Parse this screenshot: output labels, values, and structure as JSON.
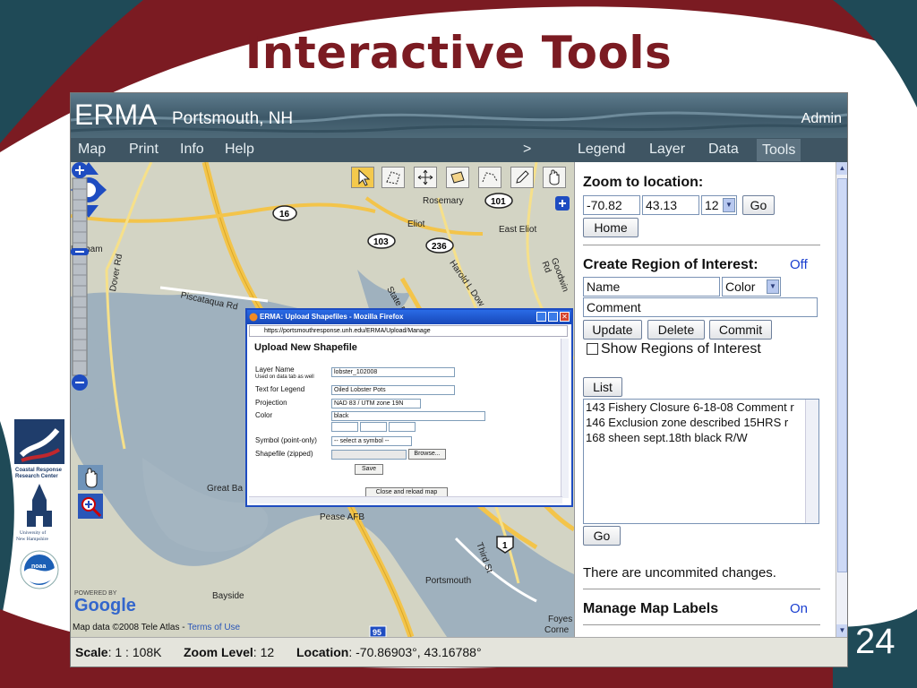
{
  "slide": {
    "title": "Interactive Tools",
    "page_number": "24",
    "logos": {
      "crrc": "Coastal Response Research Center",
      "unh": "University of New Hampshire",
      "noaa": "NOAA"
    }
  },
  "app": {
    "name": "ERMA",
    "location": "Portsmouth, NH",
    "user": "Admin"
  },
  "nav": {
    "left": [
      "Map",
      "Print",
      "Info",
      "Help"
    ],
    "arrow": ">",
    "right": [
      "Legend",
      "Layer",
      "Data",
      "Tools"
    ],
    "active": "Tools"
  },
  "map": {
    "labels": {
      "durham": "Durham",
      "piscataqua": "Piscataqua Rd",
      "rosemary": "Rosemary",
      "eliot": "Eliot",
      "east_eliot": "East Eliot",
      "great_bay": "Great Ba",
      "pease": "Pease AFB",
      "portsmouth": "Portsmouth",
      "bayside": "Bayside",
      "foyes": "Foyes",
      "corne": "Corne",
      "dover_rd": "Dover Rd",
      "harold": "Harold L Dow",
      "goodwin": "Goodwin Rd",
      "state_rt": "State Rt",
      "third": "Third St"
    },
    "shields": [
      "16",
      "101",
      "103",
      "236",
      "1",
      "95"
    ],
    "powered_by": "POWERED BY",
    "google": "Google",
    "copyright_prefix": "Map data ©2008 Tele Atlas - ",
    "terms": "Terms of Use",
    "tools": [
      "select-arrow-icon",
      "polygon-icon",
      "move-icon",
      "rectangle-icon",
      "polyline-icon",
      "pencil-icon",
      "hand-icon"
    ]
  },
  "panel": {
    "zoom_title": "Zoom to location:",
    "lon": "-70.82",
    "lat": "43.13",
    "zoom_level": "12",
    "go": "Go",
    "home": "Home",
    "roi_title": "Create Region of Interest:",
    "roi_state": "Off",
    "name_placeholder": "Name",
    "color_select": "Color",
    "comment_placeholder": "Comment",
    "update": "Update",
    "delete": "Delete",
    "commit": "Commit",
    "show_regions": "Show Regions of Interest",
    "list_btn": "List",
    "list_items": [
      "143 Fishery Closure 6-18-08 Comment r",
      "146 Exclusion zone described 15HRS r",
      "168 sheen sept.18th black R/W"
    ],
    "go2": "Go",
    "uncommitted": "There are uncommited changes.",
    "labels_title": "Manage Map Labels",
    "labels_state": "On"
  },
  "status": {
    "scale_label": "Scale",
    "scale_value": ": 1 : 108K",
    "zoom_label": "Zoom Level",
    "zoom_value": ": 12",
    "location_label": "Location",
    "location_value": ": -70.86903°, 43.16788°"
  },
  "dialog": {
    "title": "ERMA: Upload Shapefiles - Mozilla Firefox",
    "url": "https://portsmouthresponse.unh.edu/ERMA/Upload/Manage",
    "heading": "Upload New Shapefile",
    "layer_name_label": "Layer Name",
    "layer_name_sub": "Used on data tab as well",
    "layer_name_value": "lobster_102008",
    "legend_label": "Text for Legend",
    "legend_value": "Oiled Lobster Pots",
    "projection_label": "Projection",
    "projection_value": "NAD 83 / UTM zone 19N",
    "color_label": "Color",
    "color_value": "black",
    "symbol_label": "Symbol (point-only)",
    "symbol_value": "-- select a symbol --",
    "shapefile_label": "Shapefile (zipped)",
    "browse": "Browse...",
    "save": "Save",
    "close": "Close and reload map"
  },
  "colors": {
    "slide_maroon": "#7b1b22",
    "slide_teal": "#1f4a57",
    "nav_bg": "#3f5563",
    "water": "#9fb1be",
    "land": "#d2d3c4",
    "road_yellow": "#f3c44a",
    "dialog_blue": "#1e4cc1",
    "panel_link": "#1a3fd0"
  }
}
